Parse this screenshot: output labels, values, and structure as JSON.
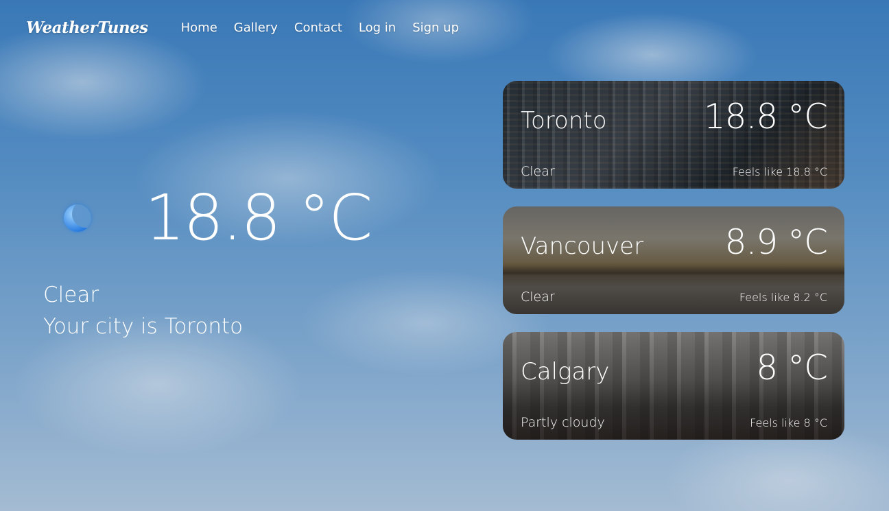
{
  "header": {
    "logo": "WeatherTunes",
    "nav": [
      {
        "label": "Home"
      },
      {
        "label": "Gallery"
      },
      {
        "label": "Contact"
      },
      {
        "label": "Log in"
      },
      {
        "label": "Sign up"
      }
    ]
  },
  "current": {
    "icon": "crescent-moon-icon",
    "temperature": "18.8 °C",
    "condition": "Clear",
    "city_text": "Your city is Toronto"
  },
  "cards": [
    {
      "city": "Toronto",
      "temperature": "18.8 °C",
      "condition": "Clear",
      "feels_like": "Feels like 18.8 °C"
    },
    {
      "city": "Vancouver",
      "temperature": "8.9 °C",
      "condition": "Clear",
      "feels_like": "Feels like 8.2 °C"
    },
    {
      "city": "Calgary",
      "temperature": "8 °C",
      "condition": "Partly cloudy",
      "feels_like": "Feels like 8 °C"
    }
  ],
  "colors": {
    "text": "#ffffff",
    "sky": "#3f82c4",
    "icon_blue": "#2a7de0"
  }
}
